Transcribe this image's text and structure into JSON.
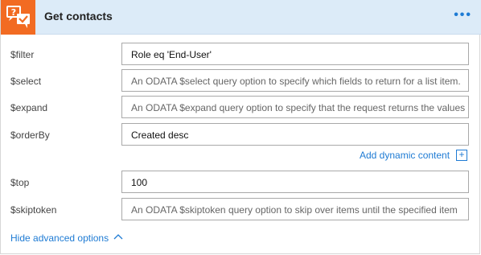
{
  "header": {
    "title": "Get contacts",
    "more_icon": "more-options-icon",
    "logo_icon": "zendesk-help-icon",
    "logo_color": "#f26b22",
    "bg_color": "#dcebf8"
  },
  "fields": [
    {
      "label": "$filter",
      "value": "Role eq 'End-User'",
      "placeholder": ""
    },
    {
      "label": "$select",
      "value": "",
      "placeholder": "An ODATA $select query option to specify which fields to return for a list item."
    },
    {
      "label": "$expand",
      "value": "",
      "placeholder": "An ODATA $expand query option to specify that the request returns the values"
    },
    {
      "label": "$orderBy",
      "value": "Created desc",
      "placeholder": ""
    },
    {
      "label": "$top",
      "value": "100",
      "placeholder": ""
    },
    {
      "label": "$skiptoken",
      "value": "",
      "placeholder": "An ODATA $skiptoken query option to skip over items until the specified item"
    }
  ],
  "dynamic_content": {
    "label": "Add dynamic content",
    "icon": "plus-icon",
    "symbol": "+"
  },
  "advanced": {
    "label": "Hide advanced options",
    "icon": "chevron-up-icon"
  },
  "accent_color": "#1e7bd4"
}
